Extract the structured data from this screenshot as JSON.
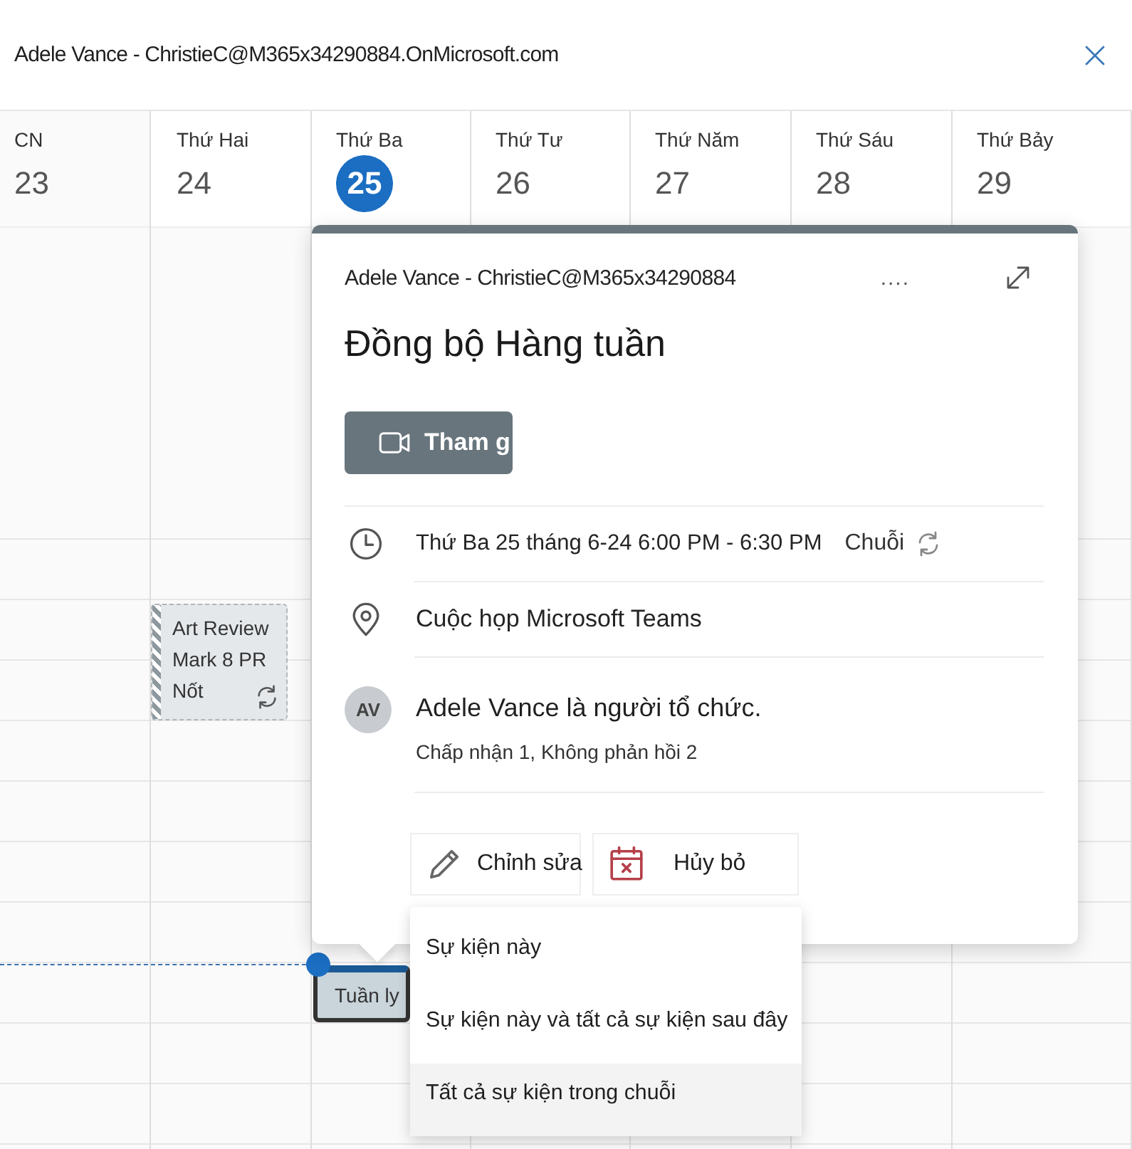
{
  "header": {
    "title": "Adele Vance - ChristieC@M365x34290884.OnMicrosoft.com"
  },
  "days": [
    {
      "name": "CN",
      "date": "23",
      "selected": false
    },
    {
      "name": "Thứ Hai",
      "date": "24",
      "selected": false
    },
    {
      "name": "Thứ Ba",
      "date": "25",
      "selected": true
    },
    {
      "name": "Thứ Tư",
      "date": "26",
      "selected": false
    },
    {
      "name": "Thứ Năm",
      "date": "27",
      "selected": false
    },
    {
      "name": "Thứ Sáu",
      "date": "28",
      "selected": false
    },
    {
      "name": "Thứ Bảy",
      "date": "29",
      "selected": false
    }
  ],
  "events": [
    {
      "kind": "tentative",
      "lines": [
        "Art Review",
        "Mark 8 PR",
        "Nốt"
      ],
      "recurring": true
    },
    {
      "kind": "selected",
      "lines": [
        "Tuần ly"
      ],
      "recurring": false
    }
  ],
  "popup": {
    "account": "Adele Vance - ChristieC@M365x34290884",
    "more": "....",
    "title": "Đồng bộ Hàng tuần",
    "join_button": "Tham g",
    "time": "Thứ Ba 25 tháng 6-24 6:00 PM - 6:30 PM",
    "series": "Chuỗi",
    "location": "Cuộc họp Microsoft Teams",
    "organizer": {
      "initials": "AV",
      "text": "Adele Vance là người tổ chức.",
      "responses": "Chấp nhận 1, Không phản hồi 2"
    },
    "actions": [
      {
        "kind": "edit",
        "label": "Chỉnh sửa"
      },
      {
        "kind": "cancel",
        "label": "Hủy bỏ"
      }
    ]
  },
  "menu": [
    {
      "label": "Sự kiện này",
      "selected": false
    },
    {
      "label": "Sự kiện này và tất cả sự kiện sau đây",
      "selected": false
    },
    {
      "label": "Tất cả sự kiện trong chuỗi",
      "selected": true
    }
  ]
}
